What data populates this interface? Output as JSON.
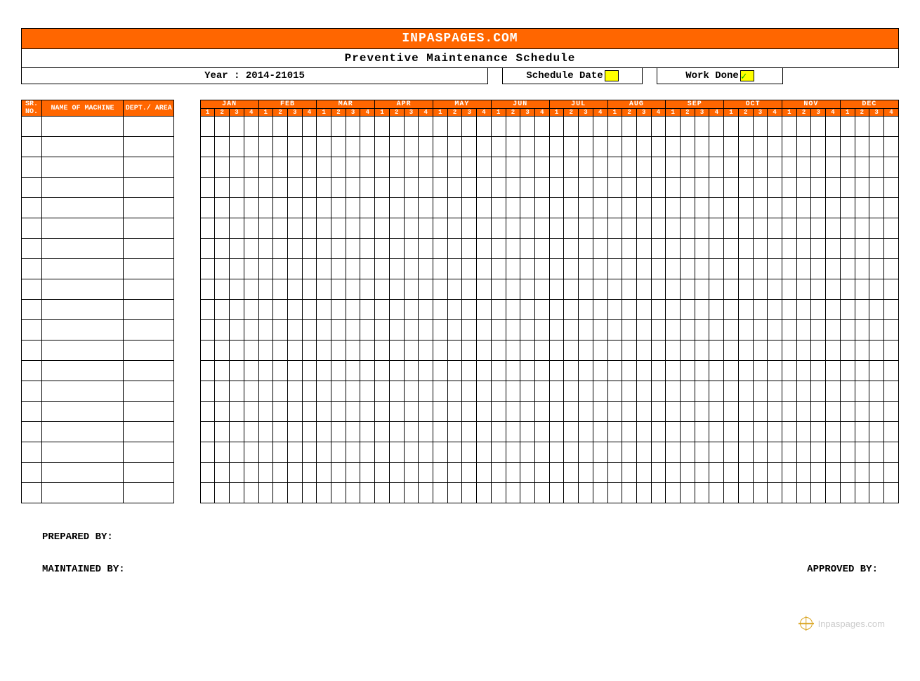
{
  "header": {
    "site": "INPASPAGES.COM",
    "title": "Preventive Maintenance Schedule",
    "year_label": "Year : 2014-21015",
    "schedule_label": "Schedule Date",
    "work_done_label": "Work Done",
    "swatch_schedule_color": "#ffff00",
    "swatch_work_color": "#ffff00",
    "work_done_symbol": "✓"
  },
  "columns": {
    "sr": "SR. NO.",
    "name": "NAME OF MACHINE",
    "dept": "DEPT./ AREA"
  },
  "months": [
    "JAN",
    "FEB",
    "MAR",
    "APR",
    "MAY",
    "JUN",
    "JUL",
    "AUG",
    "SEP",
    "OCT",
    "NOV",
    "DEC"
  ],
  "weeks": [
    "1",
    "2",
    "3",
    "4"
  ],
  "row_count": 19,
  "footer": {
    "prepared": "PREPARED BY:",
    "maintained": "MAINTAINED BY:",
    "approved": "APPROVED BY:"
  },
  "watermark": "Inpaspages.com",
  "chart_data": {
    "type": "table",
    "title": "Preventive Maintenance Schedule",
    "columns": [
      "SR. NO.",
      "NAME OF MACHINE",
      "DEPT./ AREA",
      "JAN 1",
      "JAN 2",
      "JAN 3",
      "JAN 4",
      "FEB 1",
      "FEB 2",
      "FEB 3",
      "FEB 4",
      "MAR 1",
      "MAR 2",
      "MAR 3",
      "MAR 4",
      "APR 1",
      "APR 2",
      "APR 3",
      "APR 4",
      "MAY 1",
      "MAY 2",
      "MAY 3",
      "MAY 4",
      "JUN 1",
      "JUN 2",
      "JUN 3",
      "JUN 4",
      "JUL 1",
      "JUL 2",
      "JUL 3",
      "JUL 4",
      "AUG 1",
      "AUG 2",
      "AUG 3",
      "AUG 4",
      "SEP 1",
      "SEP 2",
      "SEP 3",
      "SEP 4",
      "OCT 1",
      "OCT 2",
      "OCT 3",
      "OCT 4",
      "NOV 1",
      "NOV 2",
      "NOV 3",
      "NOV 4",
      "DEC 1",
      "DEC 2",
      "DEC 3",
      "DEC 4"
    ],
    "rows": []
  }
}
